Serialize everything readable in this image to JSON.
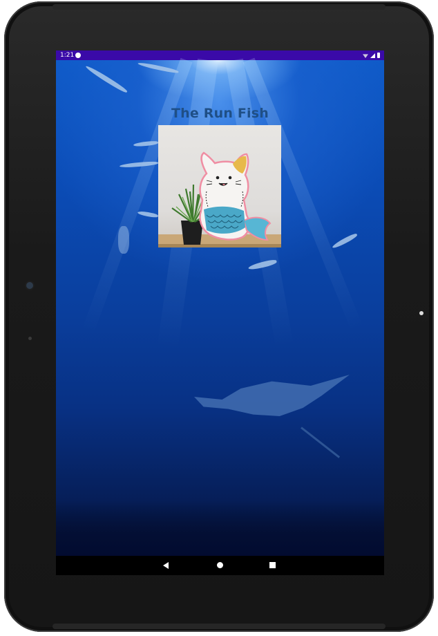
{
  "status_bar": {
    "time": "1:21",
    "app_icon": "app-notification-icon",
    "wifi_icon": "wifi-icon",
    "signal_icon": "cell-signal-icon",
    "battery_icon": "battery-icon"
  },
  "app": {
    "title": "The Run Fish",
    "image_subject": "cat-mermaid plush pillow beside potted grass plant",
    "background_subject": "underwater ocean scene with fish and manta ray"
  },
  "nav_bar": {
    "back_icon": "back-triangle-icon",
    "home_icon": "home-circle-icon",
    "recents_icon": "recents-square-icon"
  },
  "colors": {
    "status_bar": "#3a0aa8",
    "title_text": "#1f4f86",
    "nav_bar": "#000000",
    "ocean": "#0b4cb6"
  }
}
